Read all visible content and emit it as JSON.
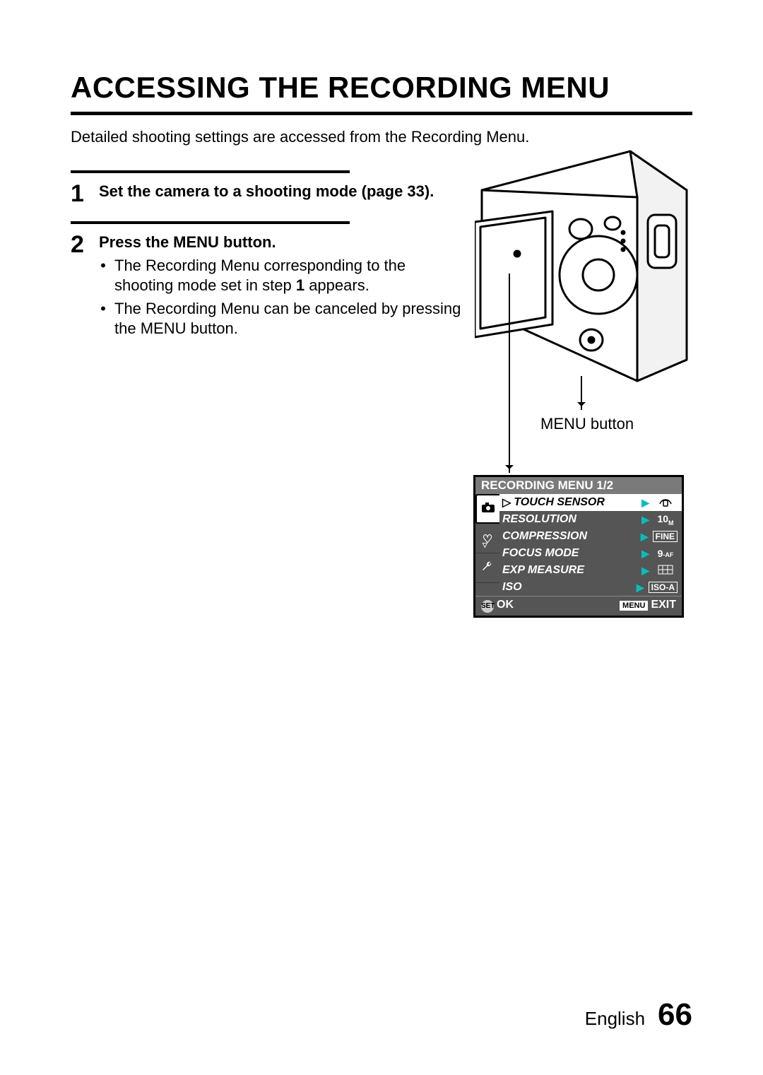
{
  "title": "ACCESSING THE RECORDING MENU",
  "intro": "Detailed shooting settings are accessed from the Recording Menu.",
  "steps": [
    {
      "num": "1",
      "head": "Set the camera to a shooting mode (page 33)."
    },
    {
      "num": "2",
      "head": "Press the MENU button.",
      "bullets": [
        "The Recording Menu corresponding to the shooting mode set in step 1 appears.",
        "The Recording Menu can be canceled by pressing the MENU button."
      ]
    }
  ],
  "callout": "MENU button",
  "screen": {
    "title": "RECORDING MENU 1/2",
    "tabs": [
      "camera",
      "heart",
      "wrench"
    ],
    "rows": [
      {
        "name": "TOUCH SENSOR",
        "value": "touch-icon",
        "hl": true
      },
      {
        "name": "RESOLUTION",
        "value": "10M"
      },
      {
        "name": "COMPRESSION",
        "value": "FINE"
      },
      {
        "name": "FOCUS MODE",
        "value": "9-AF"
      },
      {
        "name": "EXP MEASURE",
        "value": "matrix-icon"
      },
      {
        "name": "ISO",
        "value": "ISO-A"
      }
    ],
    "ok": "OK",
    "exit": "EXIT",
    "menu_box": "MENU",
    "set": "SET"
  },
  "footer": {
    "lang": "English",
    "page": "66"
  }
}
